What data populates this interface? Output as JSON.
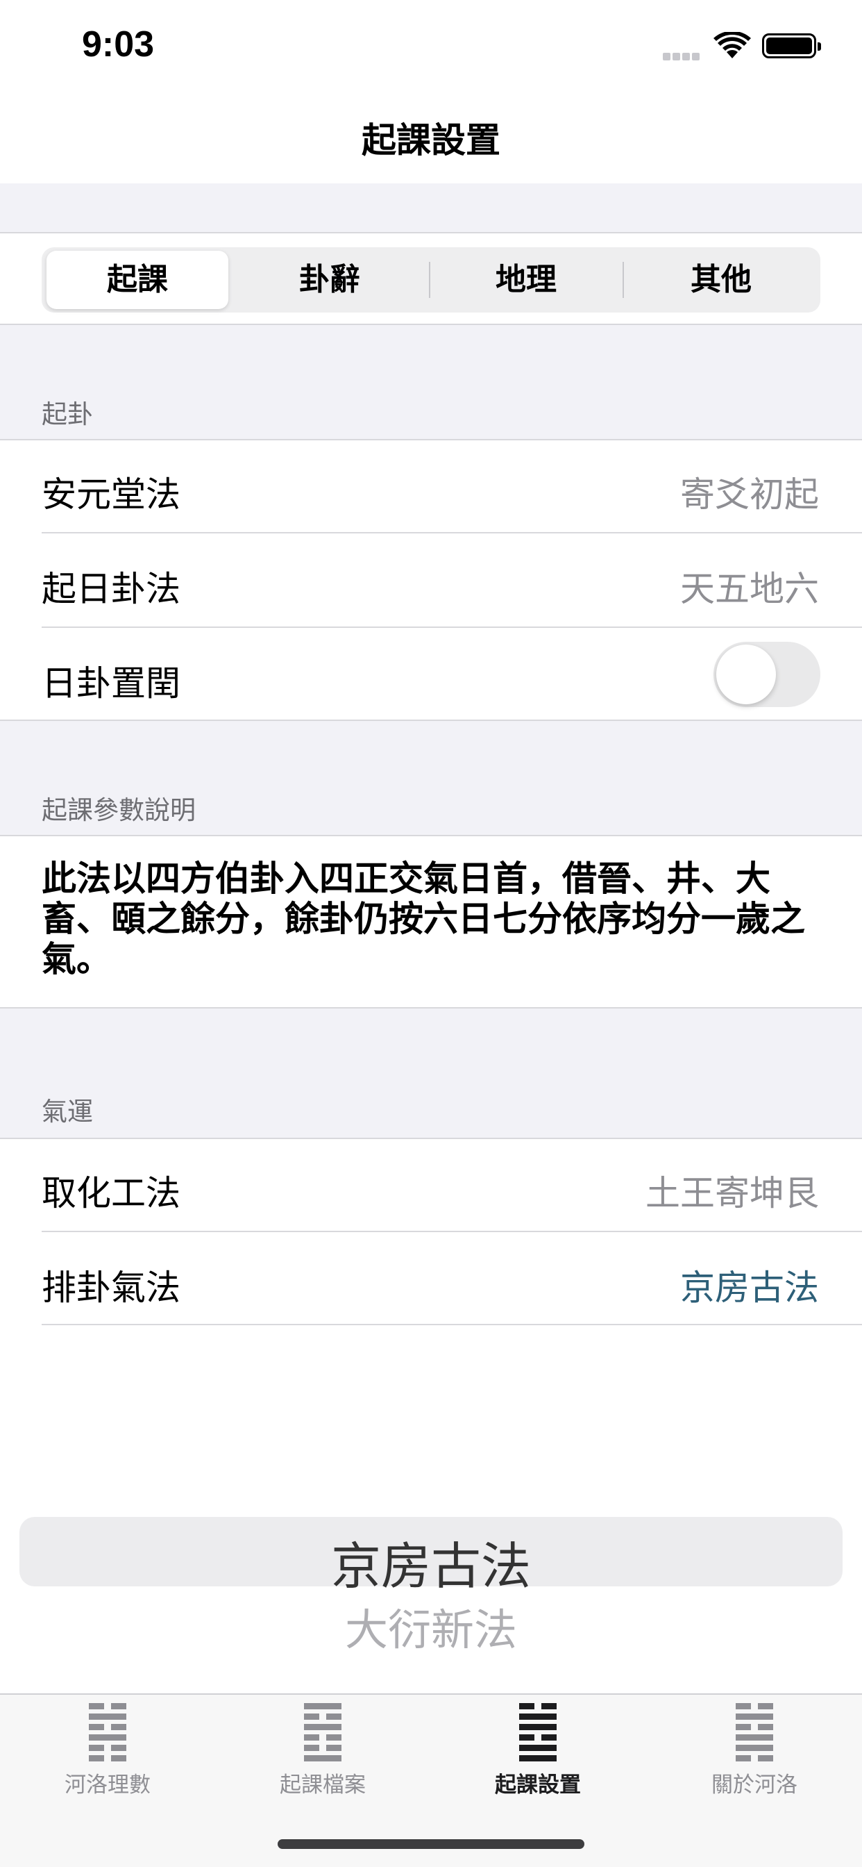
{
  "status_bar": {
    "time": "9:03"
  },
  "nav": {
    "title": "起課設置"
  },
  "segments": [
    {
      "label": "起課",
      "selected": true
    },
    {
      "label": "卦辭",
      "selected": false
    },
    {
      "label": "地理",
      "selected": false
    },
    {
      "label": "其他",
      "selected": false
    }
  ],
  "section_qigua": {
    "header": "起卦",
    "rows": [
      {
        "label": "安元堂法",
        "value": "寄爻初起"
      },
      {
        "label": "起日卦法",
        "value": "天五地六"
      },
      {
        "label": "日卦置閏",
        "toggle_on": false
      }
    ]
  },
  "section_params": {
    "header": "起課參數說明",
    "text": "此法以四方伯卦入四正交氣日首，借晉、井、大畜、頤之餘分，餘卦仍按六日七分依序均分一歲之氣。"
  },
  "section_qiyun": {
    "header": "氣運",
    "rows": [
      {
        "label": "取化工法",
        "value": "土王寄坤艮"
      },
      {
        "label": "排卦氣法",
        "value": "京房古法"
      }
    ]
  },
  "picker": {
    "selected": "京房古法",
    "next": "大衍新法"
  },
  "tab_bar": {
    "items": [
      {
        "label": "河洛理數",
        "icon": "hexagram-icon",
        "active": false
      },
      {
        "label": "起課檔案",
        "icon": "hexagram-icon",
        "active": false
      },
      {
        "label": "起課設置",
        "icon": "hexagram-icon",
        "active": true
      },
      {
        "label": "關於河洛",
        "icon": "hexagram-icon",
        "active": false
      }
    ]
  },
  "colors": {
    "accent": "#2d5f78",
    "secondary_text": "#8e8e93",
    "grouped_background": "#f2f2f7"
  }
}
